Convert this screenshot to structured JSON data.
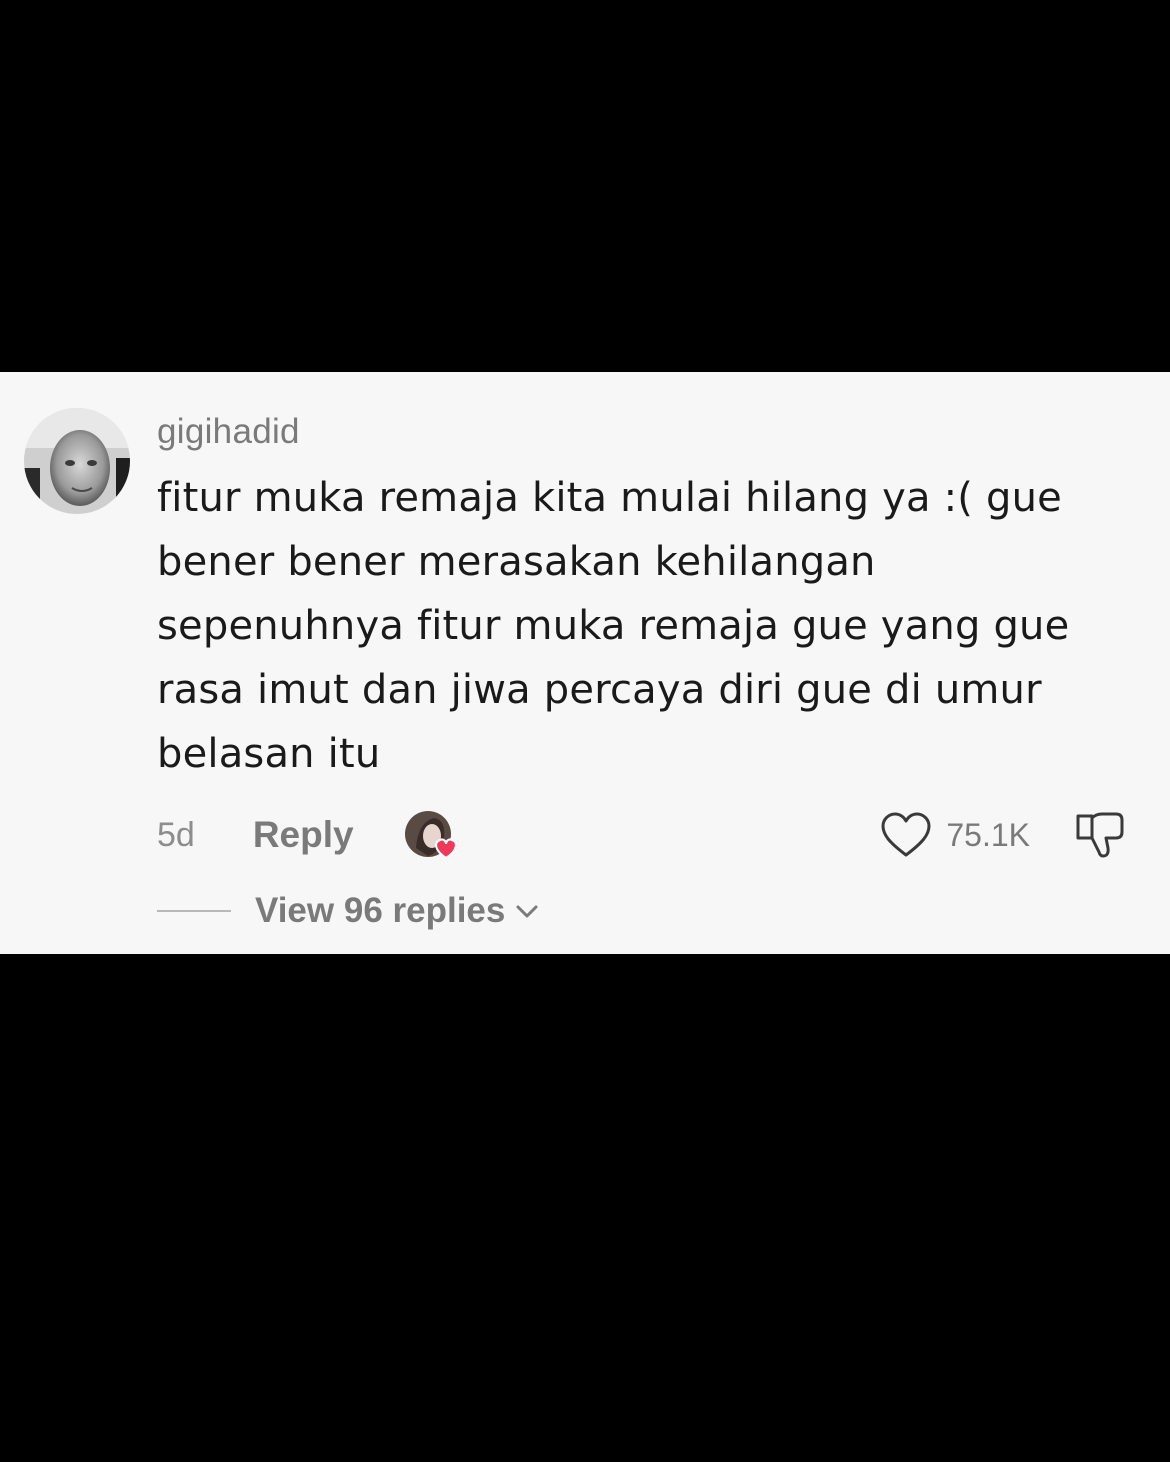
{
  "comment": {
    "username": "gigihadid",
    "text": "fitur muka remaja kita mulai hilang ya :( gue bener bener merasakan kehilangan sepenuhnya fitur muka remaja gue yang gue rasa imut dan jiwa percaya diri gue di umur belasan itu",
    "time": "5d",
    "reply_label": "Reply",
    "like_count": "75.1K",
    "view_replies_label": "View 96 replies"
  },
  "icons": {
    "avatar": "user-avatar",
    "creator_liked": "creator-liked-heart-badge",
    "like": "heart-outline-icon",
    "dislike": "thumbs-down-icon",
    "expand": "chevron-down-icon"
  },
  "colors": {
    "background": "#000000",
    "card": "#f7f7f7",
    "text": "#1a1a1a",
    "muted": "#7a7a7a",
    "heart": "#f0385a"
  }
}
